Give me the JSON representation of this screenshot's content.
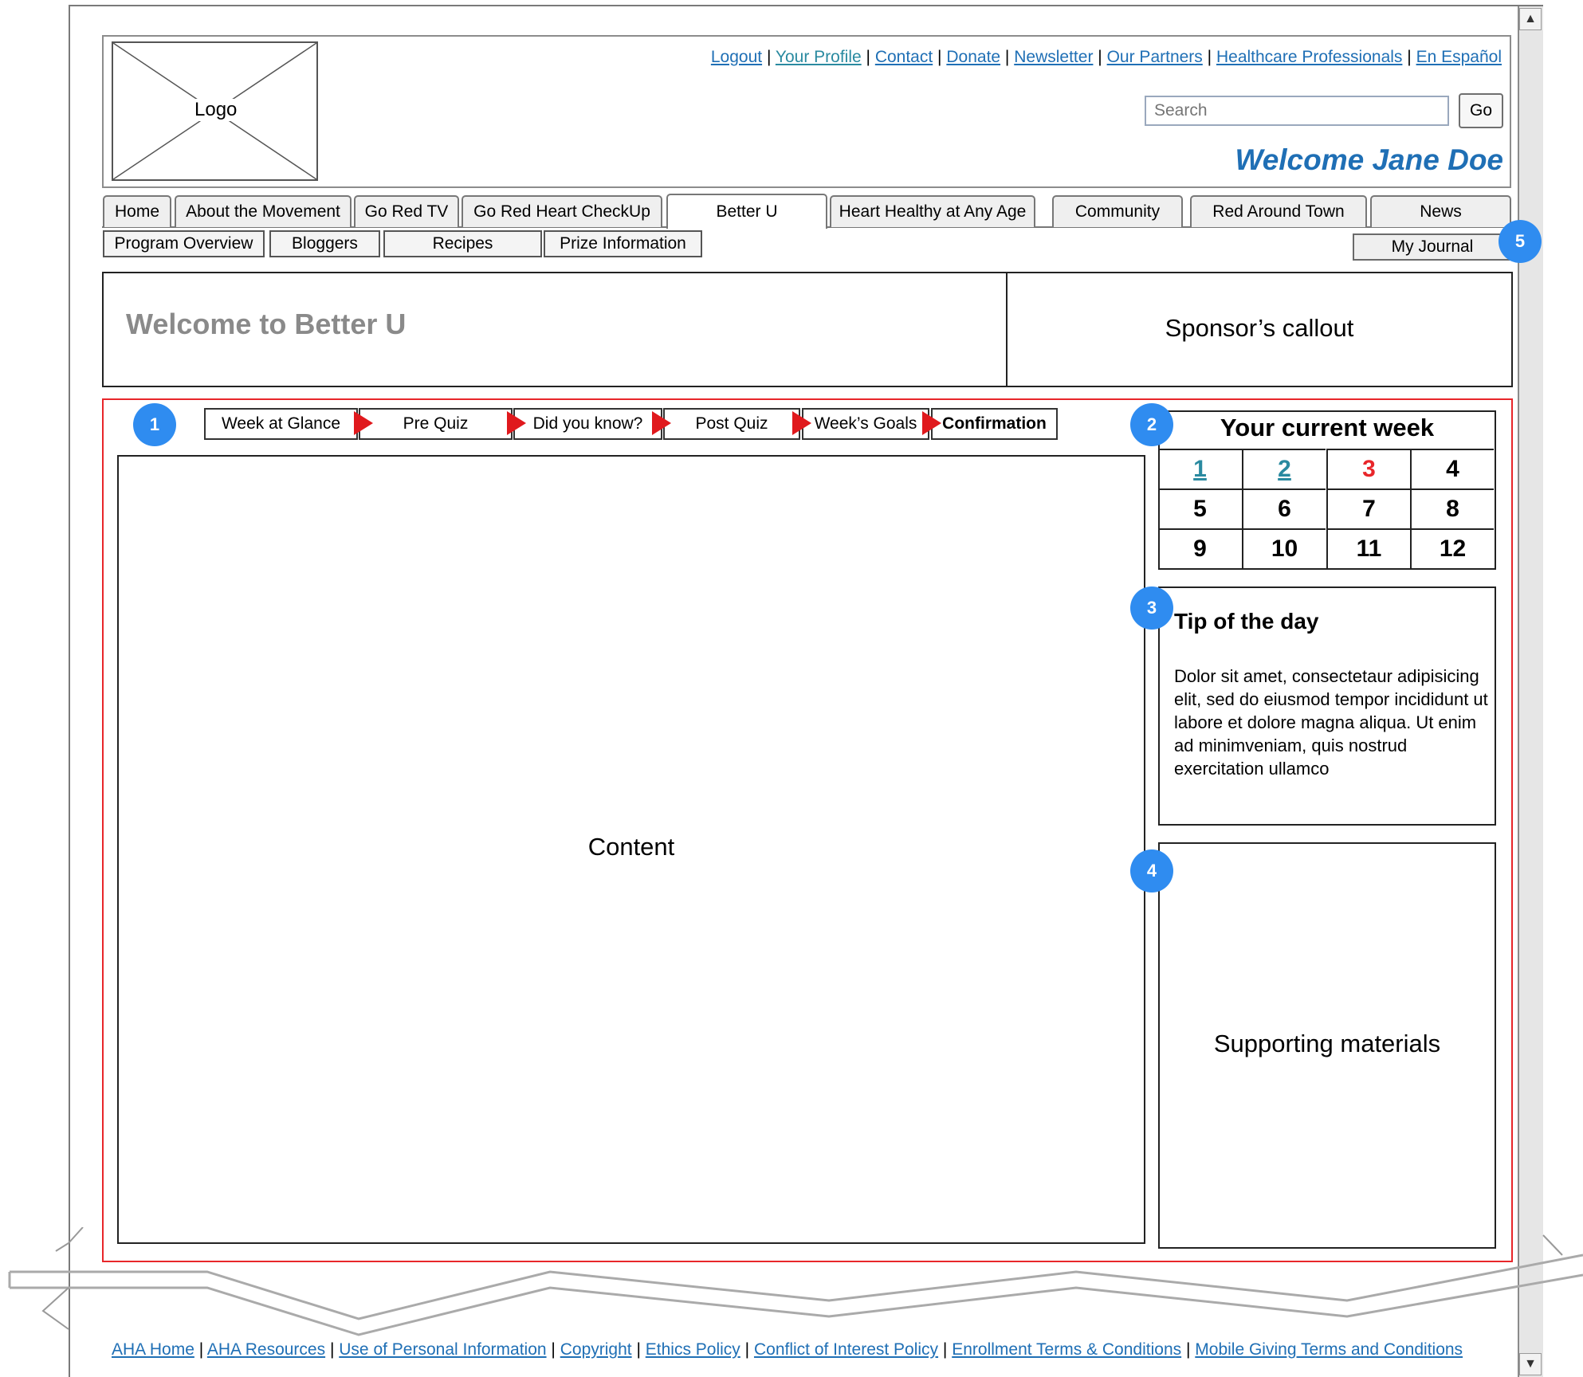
{
  "header": {
    "logo_label": "Logo",
    "utility_links": [
      "Logout",
      "Your Profile",
      "Contact",
      "Donate",
      "Newsletter",
      "Our Partners",
      "Healthcare Professionals",
      "En Español"
    ],
    "search_placeholder": "Search",
    "go_label": "Go",
    "welcome": "Welcome Jane Doe"
  },
  "primary_nav": {
    "tabs": [
      "Home",
      "About the Movement",
      "Go Red TV",
      "Go Red Heart CheckUp",
      "Better U",
      "Heart Healthy at Any Age",
      "Community",
      "Red Around Town",
      "News"
    ],
    "active": "Better U"
  },
  "sub_nav": {
    "items": [
      "Program Overview",
      "Bloggers",
      "Recipes",
      "Prize Information"
    ],
    "journal": "My Journal"
  },
  "banner": {
    "title": "Welcome to Better U",
    "sponsor": "Sponsor’s callout"
  },
  "steps": [
    "Week at Glance",
    "Pre Quiz",
    "Did you know?",
    "Post Quiz",
    "Week’s Goals",
    "Confirmation"
  ],
  "content_label": "Content",
  "week_panel": {
    "title": "Your current week",
    "weeks": [
      "1",
      "2",
      "3",
      "4",
      "5",
      "6",
      "7",
      "8",
      "9",
      "10",
      "11",
      "12"
    ],
    "completed": [
      "1",
      "2"
    ],
    "current": "3"
  },
  "tip": {
    "title": "Tip of the day",
    "text": "Dolor sit amet, consectetaur adipisicing elit, sed do eiusmod tempor incididunt ut labore et dolore magna aliqua. Ut enim ad minimveniam, quis nostrud exercitation ullamco"
  },
  "supporting_label": "Supporting materials",
  "badges": [
    "1",
    "2",
    "3",
    "4",
    "5"
  ],
  "footer_links": [
    "AHA Home",
    "AHA Resources",
    "Use of Personal Information",
    "Copyright",
    "Ethics Policy",
    "Conflict of Interest Policy",
    "Enrollment Terms & Conditions",
    "Mobile Giving Terms and Conditions"
  ],
  "colors": {
    "link": "#1f6fb5",
    "accent_red": "#e8262a",
    "badge_blue": "#2f8cf0"
  }
}
